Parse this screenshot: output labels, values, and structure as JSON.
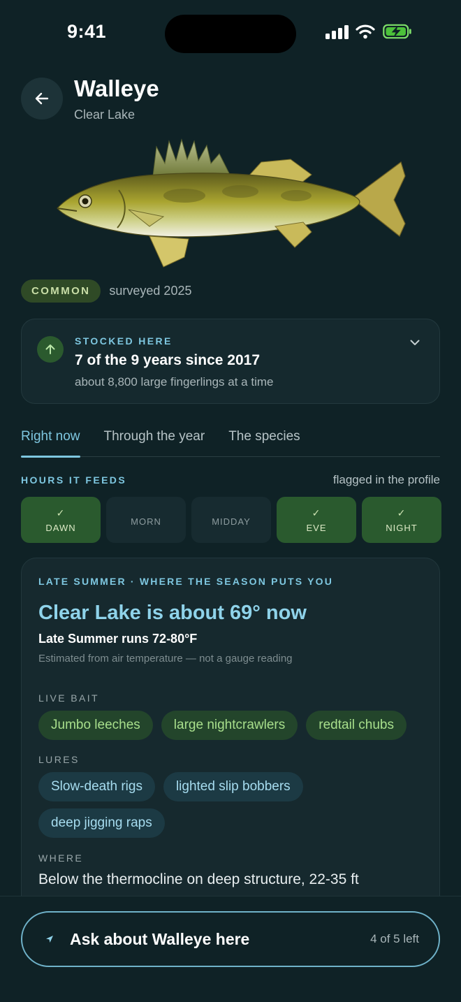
{
  "status": {
    "time": "9:41"
  },
  "header": {
    "title": "Walleye",
    "subtitle": "Clear Lake"
  },
  "rarity": {
    "badge": "COMMON",
    "survey": "surveyed 2025"
  },
  "stocked": {
    "label": "STOCKED HERE",
    "title": "7 of the 9 years since 2017",
    "detail": "about 8,800 large fingerlings at a time"
  },
  "tabs": [
    {
      "label": "Right now",
      "active": true
    },
    {
      "label": "Through the year",
      "active": false
    },
    {
      "label": "The species",
      "active": false
    }
  ],
  "hours": {
    "label": "HOURS IT FEEDS",
    "note": "flagged in the profile",
    "slots": [
      {
        "label": "DAWN",
        "on": true
      },
      {
        "label": "MORN",
        "on": false
      },
      {
        "label": "MIDDAY",
        "on": false
      },
      {
        "label": "EVE",
        "on": true
      },
      {
        "label": "NIGHT",
        "on": true
      }
    ]
  },
  "season": {
    "eyebrow": "LATE SUMMER · WHERE THE SEASON PUTS YOU",
    "title": "Clear Lake is about 69° now",
    "range": "Late Summer runs 72-80°F",
    "note": "Estimated from air temperature — not a gauge reading",
    "live_bait_label": "LIVE BAIT",
    "live_bait": [
      "Jumbo leeches",
      "large nightcrawlers",
      "redtail chubs"
    ],
    "lures_label": "LURES",
    "lures": [
      "Slow-death rigs",
      "lighted slip bobbers",
      "deep jigging raps"
    ],
    "where_label": "WHERE",
    "where": "Below the thermocline on deep structure, 22-35 ft"
  },
  "ask": {
    "label": "Ask about Walleye here",
    "remaining": "4 of 5 left"
  },
  "colors": {
    "accent": "#7ec7e0",
    "on_slot": "#2a5a2e",
    "bait_chip": "#23452b",
    "lure_chip": "#1c3a44"
  }
}
